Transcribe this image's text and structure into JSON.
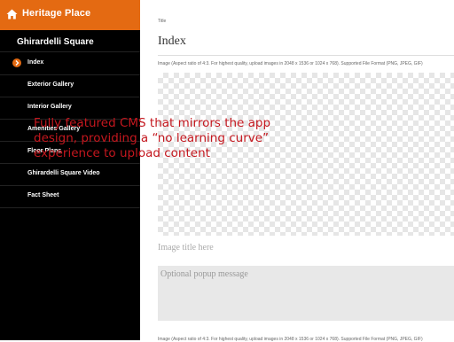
{
  "sidebar": {
    "app_title": "Heritage Place",
    "section_title": "Ghirardelli Square",
    "items": [
      {
        "label": "Index",
        "active": true
      },
      {
        "label": "Exterior Gallery",
        "active": false
      },
      {
        "label": "Interior Gallery",
        "active": false
      },
      {
        "label": "Amenities Gallery",
        "active": false
      },
      {
        "label": "Floor Plans",
        "active": false
      },
      {
        "label": "Ghirardelli Square Video",
        "active": false
      },
      {
        "label": "Fact Sheet",
        "active": false
      }
    ],
    "accent_color": "#e46a12"
  },
  "main": {
    "title_label": "Title",
    "title_value": "Index",
    "image_help": "Image (Aspect ratio of 4:3. For highest quality, upload images in 2048 x 1536 or 1024 x 768). Supported File Format (PNG, JPEG, GIF)",
    "overlay_text": "Fully featured CMS that mirrors the app design, providing a “no learning curve” experience to upload content",
    "image_title_placeholder": "Image title here",
    "popup_placeholder": "Optional popup message",
    "image_help_bottom": "Image (Aspect ratio of 4:3. For highest quality, upload images in 2048 x 1536 or 1024 x 768). Supported File Format (PNG, JPEG, GIF)"
  }
}
